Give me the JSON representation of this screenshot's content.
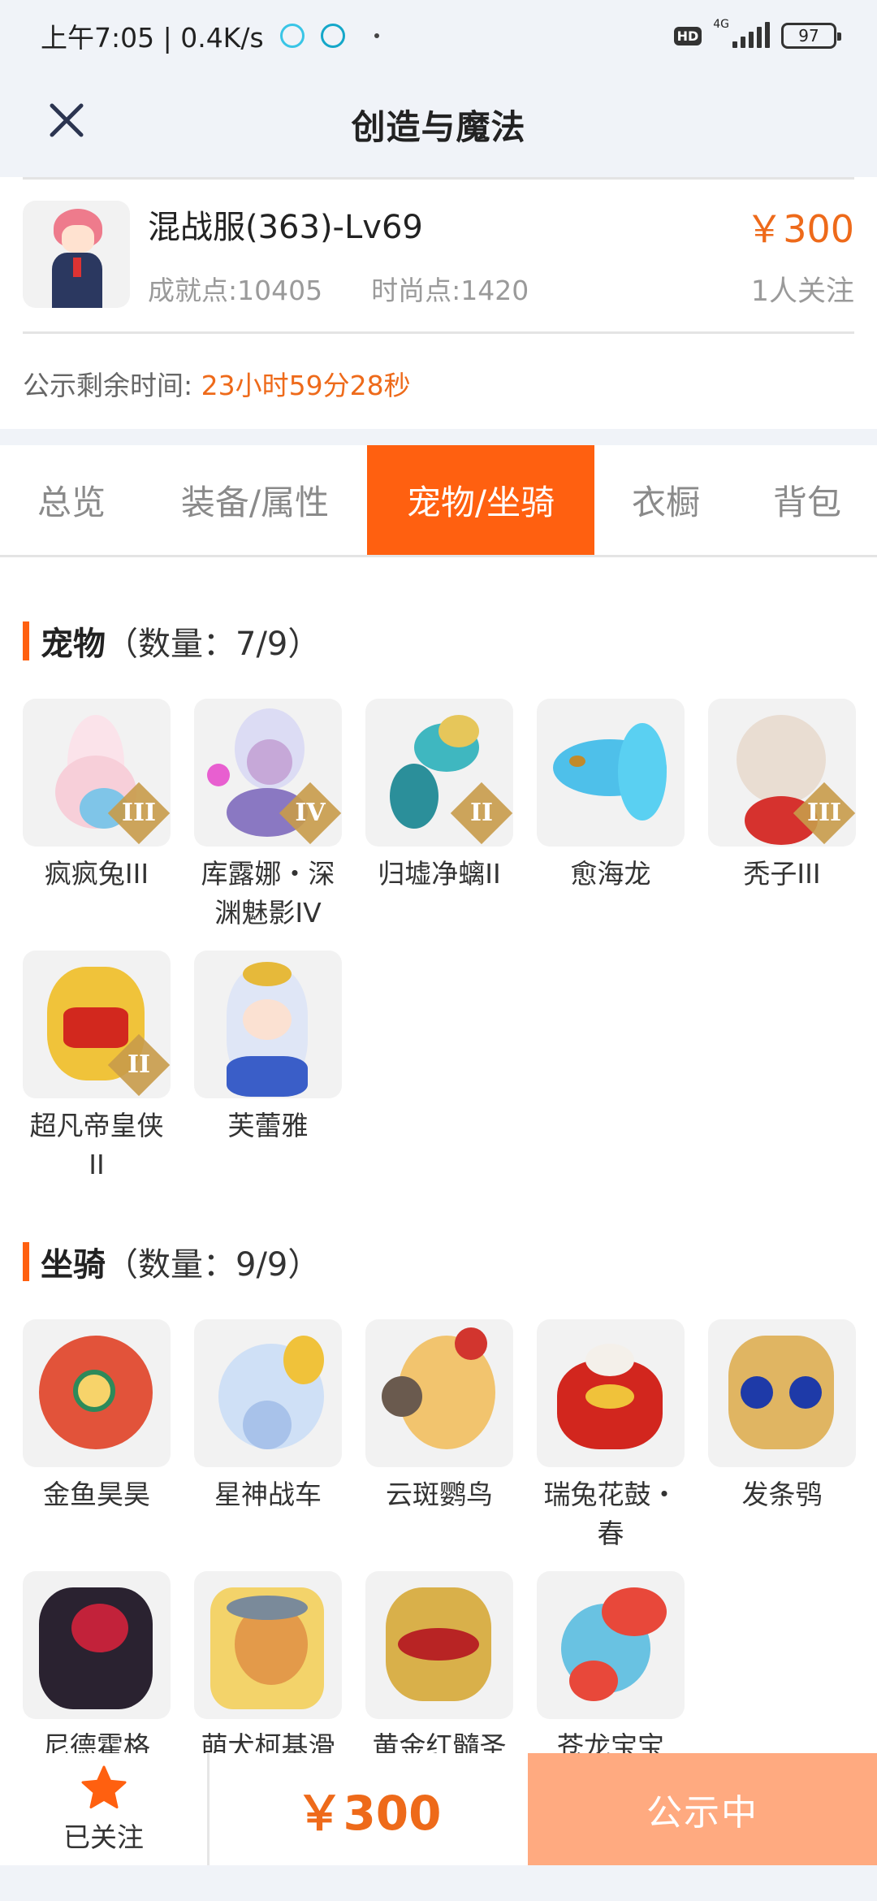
{
  "status_bar": {
    "time": "上午7:05 | 0.4K/s",
    "hd": "HD",
    "network": "4G",
    "battery": "97"
  },
  "header": {
    "title": "创造与魔法",
    "close_icon": "close-icon"
  },
  "item": {
    "server": "混战服(363)-Lv69",
    "achievement": "成就点:10405",
    "fashion": "时尚点:1420",
    "price": "￥300",
    "followers": "1人关注",
    "notice_label": "公示剩余时间:",
    "notice_time": "23小时59分28秒"
  },
  "tabs": [
    {
      "label": "总览",
      "active": false
    },
    {
      "label": "装备/属性",
      "active": false
    },
    {
      "label": "宠物/坐骑",
      "active": true
    },
    {
      "label": "衣橱",
      "active": false
    },
    {
      "label": "背包",
      "active": false
    }
  ],
  "pets": {
    "title": "宠物",
    "count": "（数量：7/9）",
    "items": [
      {
        "name": "疯疯兔III",
        "tier": "III"
      },
      {
        "name": "库露娜・深渊魅影IV",
        "tier": "IV"
      },
      {
        "name": "归墟净螭II",
        "tier": "II"
      },
      {
        "name": "愈海龙",
        "tier": ""
      },
      {
        "name": "秃子III",
        "tier": "III"
      },
      {
        "name": "超凡帝皇侠II",
        "tier": "II"
      },
      {
        "name": "芙蕾雅",
        "tier": ""
      }
    ]
  },
  "mounts": {
    "title": "坐骑",
    "count": "（数量：9/9）",
    "items": [
      {
        "name": "金鱼昊昊"
      },
      {
        "name": "星神战车"
      },
      {
        "name": "云斑鹦鸟"
      },
      {
        "name": "瑞兔花鼓・春"
      },
      {
        "name": "发条鸮"
      },
      {
        "name": "尼德霍格"
      },
      {
        "name": "萌犬柯基滑"
      },
      {
        "name": "黄金红髓圣"
      },
      {
        "name": "苍龙宝宝"
      }
    ]
  },
  "bottom_bar": {
    "follow_label": "已关注",
    "price": "￥300",
    "action_label": "公示中"
  },
  "colors": {
    "accent": "#ff6010",
    "price": "#ee6a1a",
    "action_bg": "#ffaa80",
    "header_bg": "#f0f3f8"
  }
}
